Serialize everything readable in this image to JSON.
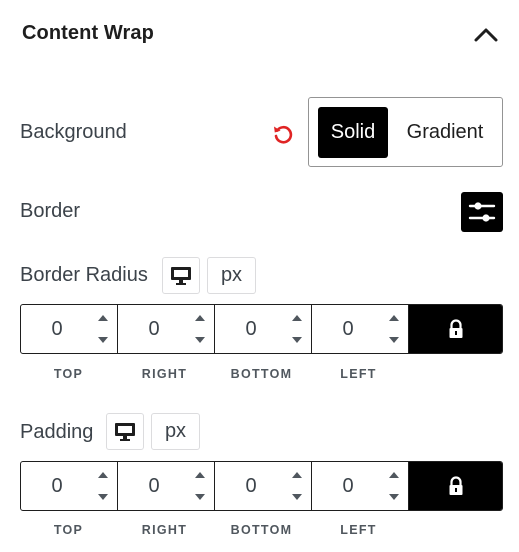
{
  "panel": {
    "title": "Content Wrap",
    "collapse_icon": "chevron-up-icon"
  },
  "background": {
    "label": "Background",
    "reset_icon": "reset-icon",
    "reset_color": "#e02424",
    "options": [
      "Solid",
      "Gradient"
    ],
    "selected": "Solid"
  },
  "border": {
    "label": "Border",
    "settings_icon": "sliders-icon"
  },
  "border_radius": {
    "label": "Border Radius",
    "device_icon": "desktop-icon",
    "unit": "px",
    "values": [
      "0",
      "0",
      "0",
      "0"
    ],
    "sides": [
      "TOP",
      "RIGHT",
      "BOTTOM",
      "LEFT"
    ],
    "lock_icon": "lock-icon"
  },
  "padding": {
    "label": "Padding",
    "device_icon": "desktop-icon",
    "unit": "px",
    "values": [
      "0",
      "0",
      "0",
      "0"
    ],
    "sides": [
      "TOP",
      "RIGHT",
      "BOTTOM",
      "LEFT"
    ],
    "lock_icon": "lock-icon"
  }
}
